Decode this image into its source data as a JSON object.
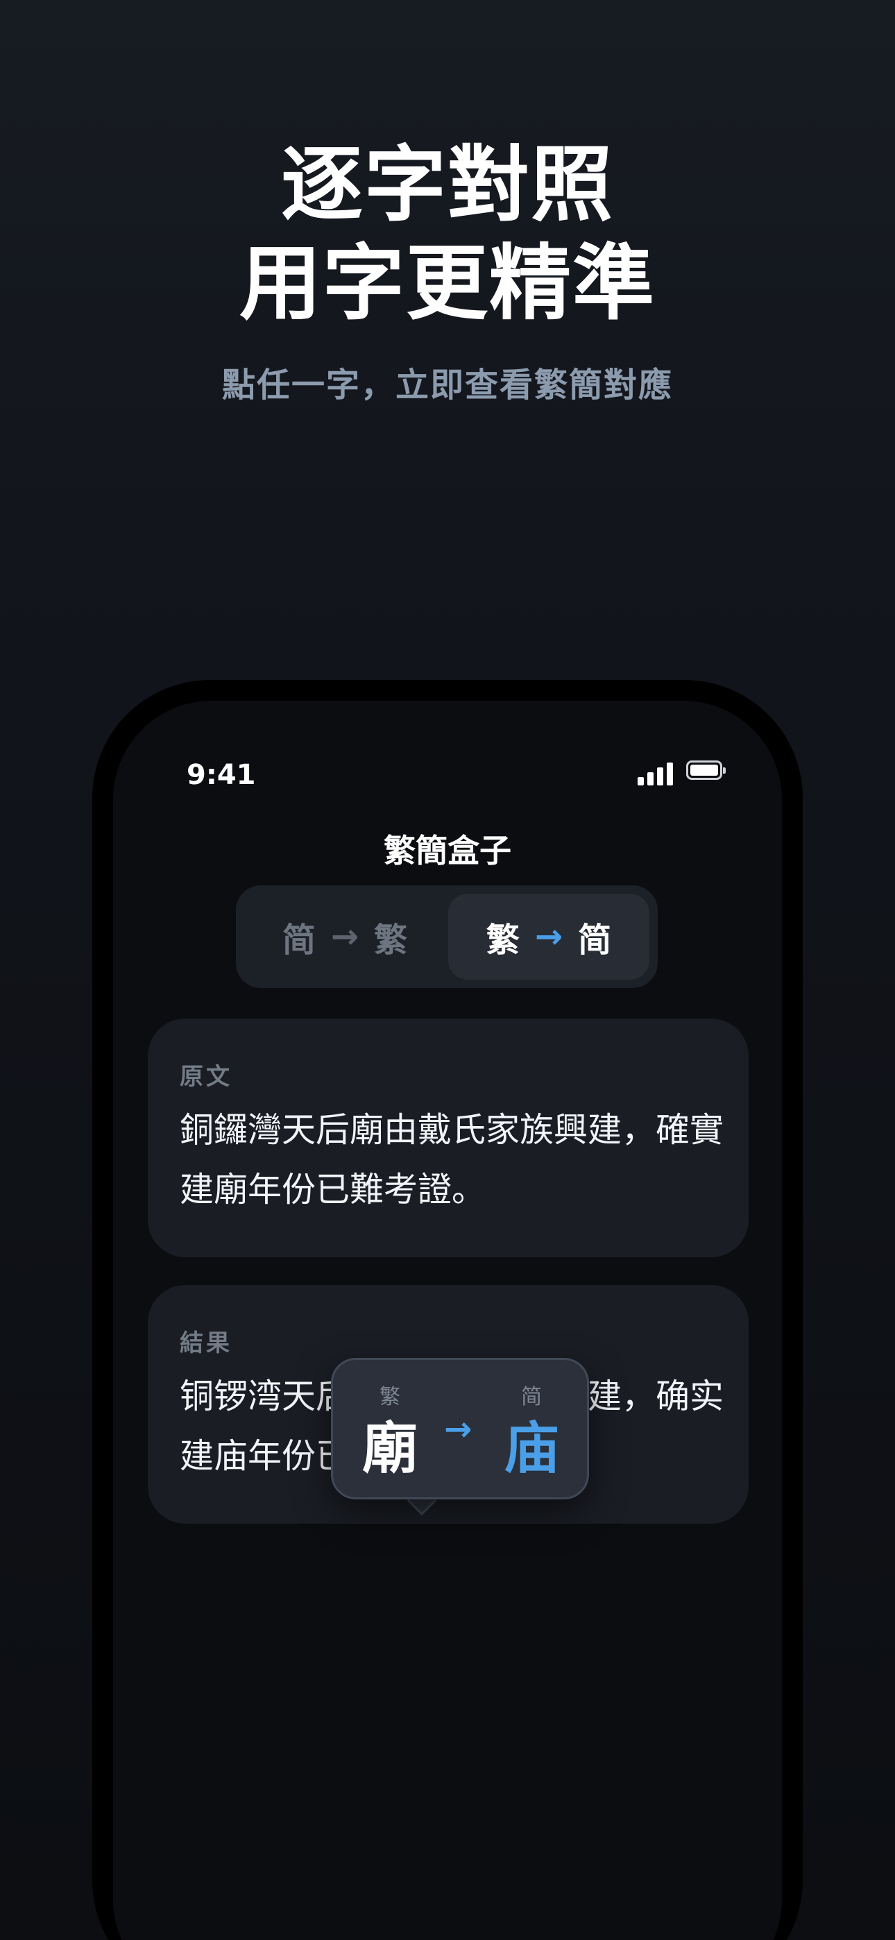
{
  "promo": {
    "headline_line1": "逐字對照",
    "headline_line2": "用字更精準",
    "subhead": "點任一字，立即查看繁簡對應"
  },
  "status_bar": {
    "time": "9:41"
  },
  "app": {
    "title": "繁簡盒子"
  },
  "mode_switch": {
    "option_a": {
      "from": "简",
      "arrow": "→",
      "to": "繁",
      "selected": false
    },
    "option_b": {
      "from": "繁",
      "arrow": "→",
      "to": "简",
      "selected": true
    }
  },
  "source_card": {
    "label": "原文",
    "text": "銅鑼灣天后廟由戴氏家族興建，確實建廟年份已難考證。"
  },
  "result_card": {
    "label": "結果",
    "text": "铜锣湾天后庙由戴氏家族兴建，确实建庙年份已难考证。"
  },
  "char_popover": {
    "from_label": "繁",
    "from_char": "廟",
    "arrow": "→",
    "to_label": "简",
    "to_char": "庙"
  },
  "colors": {
    "accent": "#4a9fe8",
    "background": "#11141a",
    "card": "#1a1d24"
  }
}
